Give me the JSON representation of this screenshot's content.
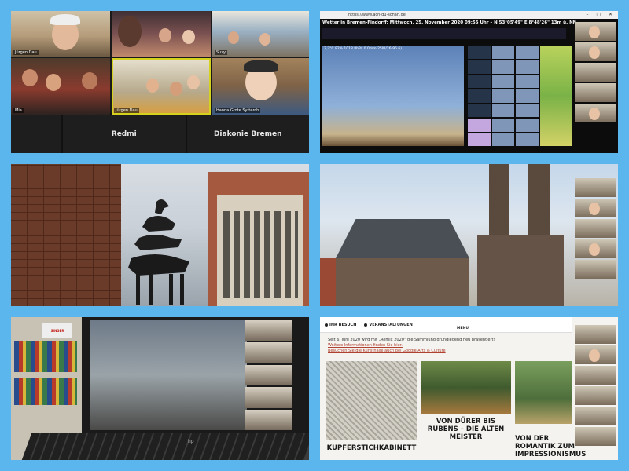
{
  "panel1": {
    "tiles": [
      {
        "name": "Jürgen Dau"
      },
      {
        "name": ""
      },
      {
        "name": "Suzy"
      },
      {
        "name": "Mia"
      },
      {
        "name": "Jürgen Dau"
      },
      {
        "name": "Hanna Grote Sytterch"
      }
    ],
    "bottom_labels": [
      "",
      "Redmi",
      "Diakonie Bremen"
    ]
  },
  "panel2": {
    "url": "https://www.ach-du-schan.de",
    "title": "Wetter in Bremen-Findorff:  Mittwoch, 25. November 2020  09:55 Uhr  –  N 53°05'49\" E 8°48'26\"  13m ü. NN",
    "readings": "3,3°C   82%   1018.8hPa   0.0mm   25W/26(95.6)"
  },
  "panel5": {
    "brand": "SINGER",
    "laptop_brand": "hp"
  },
  "panel6": {
    "nav": [
      {
        "label": "IHR BESUCH"
      },
      {
        "label": "VERANSTALTUNGEN"
      }
    ],
    "menu_label": "MENU",
    "intro": "Seit 6. Juni 2020 wird mit „Remix 2020\" die Sammlung grundlegend neu präsentiert!",
    "link1": "Weitere Informationen finden Sie hier.",
    "link2": "Besuchen Sie die Kunsthalle auch bei Google Arts & Culture",
    "cards": [
      {
        "label": "KUPFERSTICHKABINETT"
      },
      {
        "label": "VON DÜRER BIS RUBENS – DIE ALTEN MEISTER"
      },
      {
        "label": "VON DER ROMANTIK ZUM IMPRESSIONISMUS"
      }
    ]
  }
}
